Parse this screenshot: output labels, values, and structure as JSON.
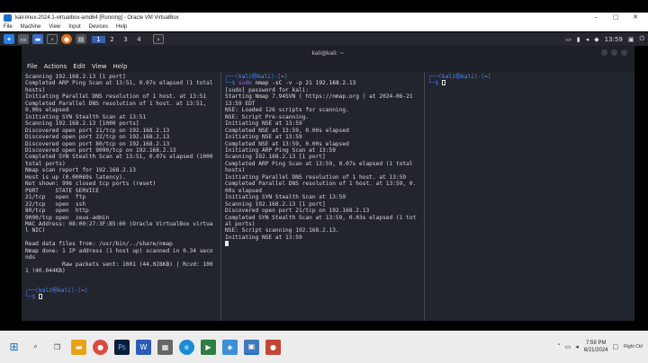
{
  "vbox": {
    "title": "kali-linux-2024.1-virtualbox-amd64 [Running] - Oracle VM VirtualBox",
    "menu": [
      "File",
      "Machine",
      "View",
      "Input",
      "Devices",
      "Help"
    ]
  },
  "kali_panel": {
    "workspaces": [
      "1",
      "2",
      "3",
      "4"
    ],
    "clock": "13:59"
  },
  "terminal": {
    "title": "kali@kali: ~",
    "menu": [
      "File",
      "Actions",
      "Edit",
      "View",
      "Help"
    ],
    "prompt_user": "kali",
    "prompt_host": "kali",
    "prompt_dir": "~",
    "left_output": "Scanning 192.168.2.13 [1 port]\nCompleted ARP Ping Scan at 13:51, 0.07s elapsed (1 total hosts)\nInitiating Parallel DNS resolution of 1 host. at 13:51\nCompleted Parallel DNS resolution of 1 host. at 13:51, 0.00s elapsed\nInitiating SYN Stealth Scan at 13:51\nScanning 192.168.2.13 [1000 ports]\nDiscovered open port 21/tcp on 192.168.2.13\nDiscovered open port 22/tcp on 192.168.2.13\nDiscovered open port 80/tcp on 192.168.2.13\nDiscovered open port 9090/tcp on 192.168.2.13\nCompleted SYN Stealth Scan at 13:51, 0.07s elapsed (1000 total ports)\nNmap scan report for 192.168.2.13\nHost is up (0.00069s latency).\nNot shown: 996 closed tcp ports (reset)\nPORT     STATE SERVICE\n21/tcp   open  ftp\n22/tcp   open  ssh\n80/tcp   open  http\n9090/tcp open  zeus-admin\nMAC Address: 08:00:27:3F:B5:60 (Oracle VirtualBox virtual NIC)\n\nRead data files from: /usr/bin/../share/nmap\nNmap done: 1 IP address (1 host up) scanned in 0.34 seconds\n           Raw packets sent: 1001 (44.028KB) | Rcvd: 1001 (40.044KB)",
    "mid_cmd": "sudo",
    "mid_cmd_rest": "nmap -sC -v -p 21 192.168.2.13",
    "mid_output": "[sudo] password for kali:\nStarting Nmap 7.94SVN ( https://nmap.org ) at 2024-06-21 13:59 EDT\nNSE: Loaded 126 scripts for scanning.\nNSE: Script Pre-scanning.\nInitiating NSE at 13:59\nCompleted NSE at 13:59, 0.00s elapsed\nInitiating NSE at 13:59\nCompleted NSE at 13:59, 0.00s elapsed\nInitiating ARP Ping Scan at 13:59\nScanning 192.168.2.13 [1 port]\nCompleted ARP Ping Scan at 13:59, 0.07s elapsed (1 total hosts)\nInitiating Parallel DNS resolution of 1 host. at 13:59\nCompleted Parallel DNS resolution of 1 host. at 13:59, 0.00s elapsed\nInitiating SYN Stealth Scan at 13:59\nScanning 192.168.2.13 [1 port]\nDiscovered open port 21/tcp on 192.168.2.13\nCompleted SYN Stealth Scan at 13:59, 0.03s elapsed (1 total ports)\nNSE: Script scanning 192.168.2.13.\nInitiating NSE at 13:59"
  },
  "windows": {
    "time": "7:59 PM",
    "date": "6/21/2024",
    "right_ctrl": "Right Ctrl"
  },
  "colors": {
    "terminal_bg": "#23252e",
    "prompt_blue": "#3d7df5",
    "command_purple": "#9c6cf2"
  }
}
